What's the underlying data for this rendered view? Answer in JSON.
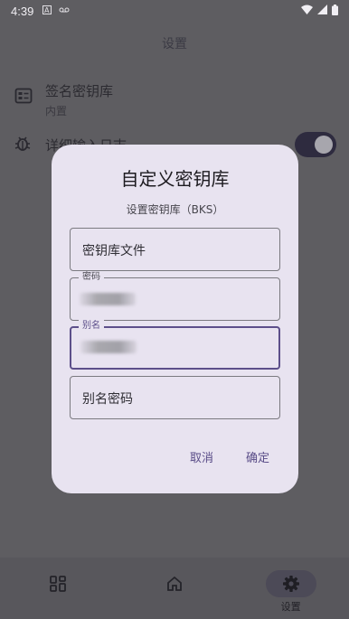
{
  "status_bar": {
    "time": "4:39",
    "icons": [
      "a-notification-icon",
      "voicemail-icon",
      "wifi-icon",
      "signal-icon",
      "battery-icon"
    ]
  },
  "page": {
    "title": "设置",
    "settings": [
      {
        "title": "签名密钥库",
        "subtitle": "内置",
        "icon": "keystore-icon"
      },
      {
        "title": "详细输入日志",
        "icon": "bug-icon",
        "toggle_on": true
      }
    ]
  },
  "dialog": {
    "title": "自定义密钥库",
    "subtitle": "设置密钥库（BKS）",
    "fields": {
      "keystore_file": {
        "placeholder": "密钥库文件"
      },
      "password": {
        "label": "密码",
        "value_redacted": true
      },
      "alias": {
        "label": "别名",
        "value_redacted": true
      },
      "alias_password": {
        "placeholder": "别名密码"
      }
    },
    "cancel_label": "取消",
    "confirm_label": "确定"
  },
  "bottom_nav": {
    "items": [
      {
        "icon": "grid-icon",
        "label": ""
      },
      {
        "icon": "home-icon",
        "label": ""
      },
      {
        "icon": "gear-icon",
        "label": "设置",
        "active": true
      }
    ]
  },
  "colors": {
    "scrim_background": "#5e5d61",
    "dialog_background": "#e8e3f0",
    "accent": "#5c4f8a"
  }
}
